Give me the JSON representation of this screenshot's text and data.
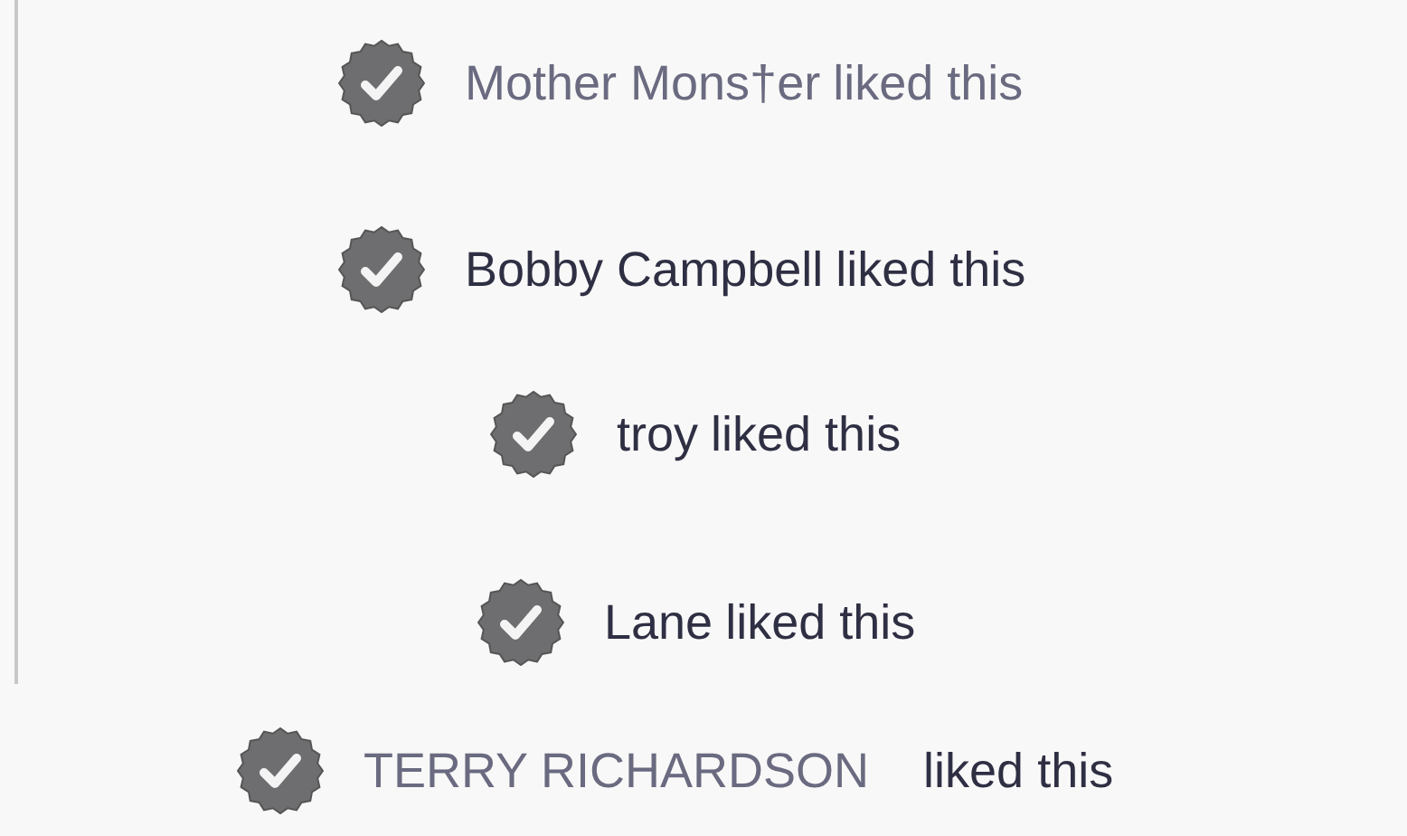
{
  "likes": [
    {
      "name": {
        "text": "Mother Mons†er",
        "dimmed": true
      },
      "action": {
        "text": "liked this",
        "dimmed": true
      }
    },
    {
      "name": {
        "text": "Bobby Campbell",
        "dimmed": false
      },
      "action": {
        "text": "liked this",
        "dimmed": false
      }
    },
    {
      "name": {
        "text": "troy",
        "dimmed": false
      },
      "action": {
        "text": "liked this",
        "dimmed": false
      }
    },
    {
      "name": {
        "text": "Lane",
        "dimmed": false
      },
      "action": {
        "text": "liked this",
        "dimmed": false
      }
    },
    {
      "name": {
        "text": "TERRY RICHARDSON",
        "dimmed": true
      },
      "action": {
        "text": "liked this",
        "dimmed": false
      }
    }
  ]
}
